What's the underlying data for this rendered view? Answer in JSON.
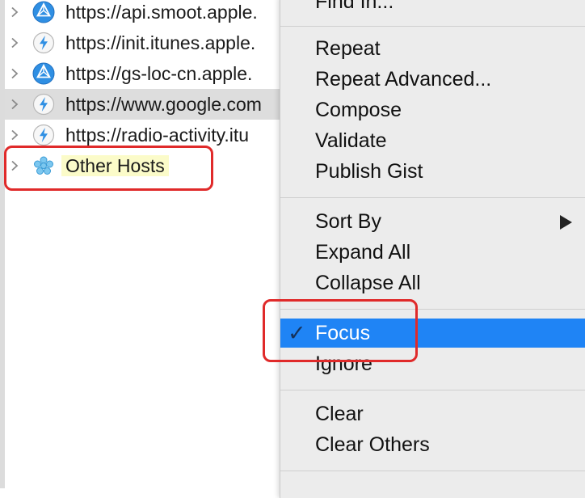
{
  "host_list": {
    "rows": [
      {
        "label": "https://api.smoot.apple.",
        "icon": "globe-icon"
      },
      {
        "label": "https://init.itunes.apple.",
        "icon": "lightning-icon"
      },
      {
        "label": "https://gs-loc-cn.apple.",
        "icon": "globe-icon"
      },
      {
        "label": "https://www.google.com",
        "icon": "lightning-icon"
      },
      {
        "label": "https://radio-activity.itu",
        "icon": "lightning-icon"
      },
      {
        "label": "Other Hosts",
        "icon": "cluster-icon"
      }
    ],
    "selected_index": 3
  },
  "context_menu": {
    "top_item": "Find In...",
    "group1": [
      "Repeat",
      "Repeat Advanced...",
      "Compose",
      "Validate",
      "Publish Gist"
    ],
    "group2": [
      "Sort By",
      "Expand All",
      "Collapse All"
    ],
    "group3": [
      "Focus",
      "Ignore"
    ],
    "group4": [
      "Clear",
      "Clear Others"
    ],
    "checked_item": "Focus",
    "highlighted_item": "Focus",
    "submenu_item": "Sort By"
  },
  "colors": {
    "highlight": "#1f84f5",
    "annotation": "#e02a2a",
    "label_highlight": "#fbfbc9"
  }
}
